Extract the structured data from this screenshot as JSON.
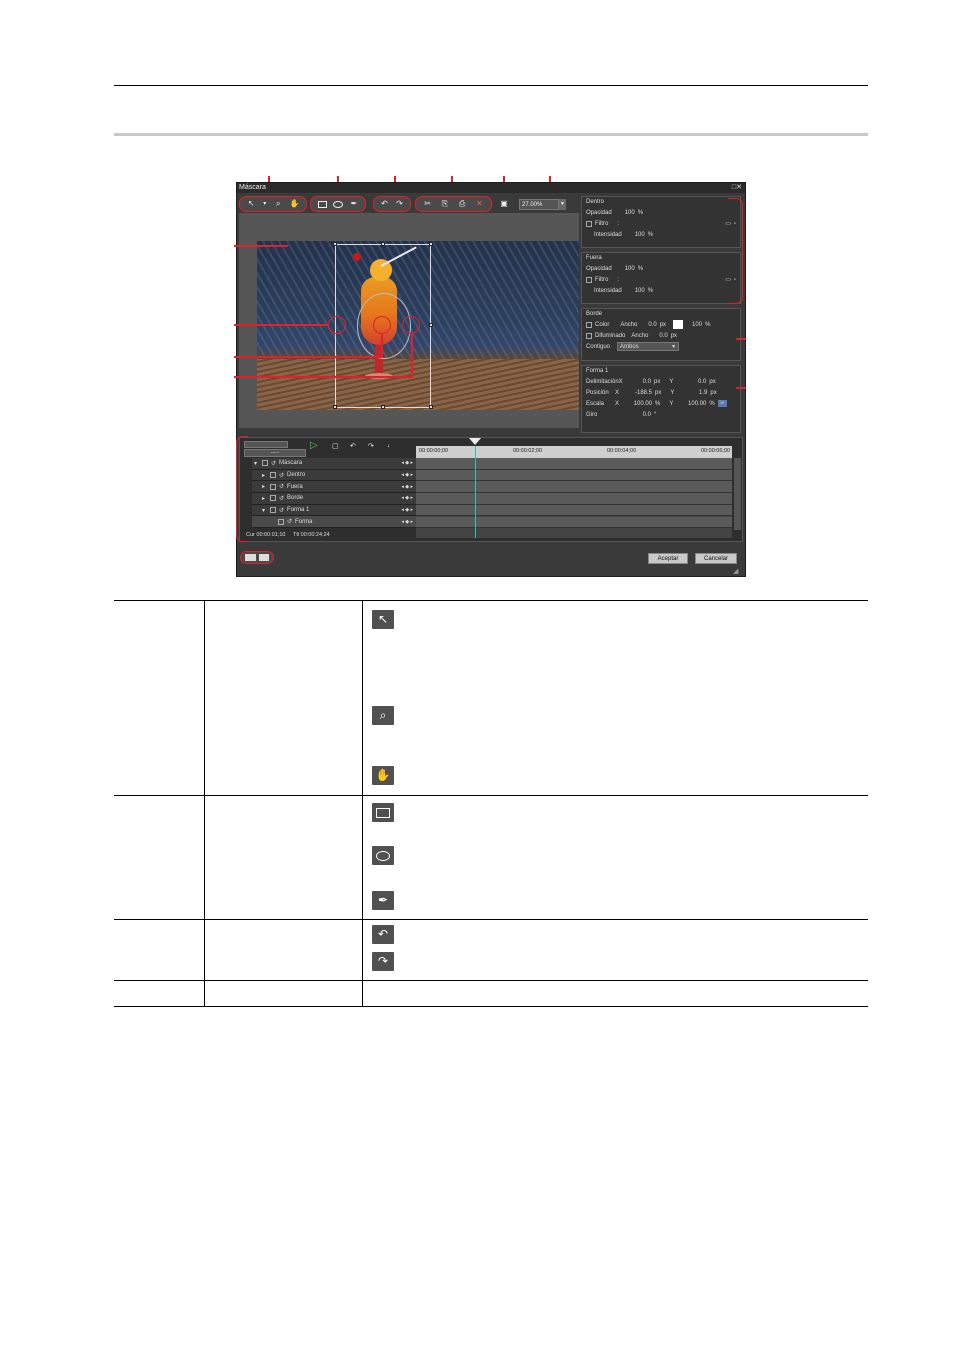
{
  "dialog": {
    "title": "Máscara",
    "window_buttons": "□✕",
    "toolbar": {
      "zoom_value": "27.00%",
      "groups": [
        {
          "name": "tools",
          "icons": [
            "arrow-icon",
            "zoom-icon",
            "hand-icon"
          ]
        },
        {
          "name": "shapes",
          "icons": [
            "rectangle-icon",
            "ellipse-icon",
            "pen-icon"
          ]
        },
        {
          "name": "history",
          "icons": [
            "undo-icon",
            "redo-icon"
          ]
        },
        {
          "name": "edit",
          "icons": [
            "cut-icon",
            "copy-icon",
            "paste-icon",
            "delete-icon"
          ]
        }
      ]
    },
    "panel": {
      "dentro": {
        "title": "Dentro",
        "opacidad_label": "Opacidad",
        "opacidad_value": "100",
        "opacidad_unit": "%",
        "filtro_label": "Filtro",
        "filtro_value": ":",
        "intensidad_label": "Intensidad",
        "intensidad_value": "100",
        "intensidad_unit": "%"
      },
      "fuera": {
        "title": "Fuera",
        "opacidad_label": "Opacidad",
        "opacidad_value": "100",
        "opacidad_unit": "%",
        "filtro_label": "Filtro",
        "filtro_value": ":",
        "intensidad_label": "Intensidad",
        "intensidad_value": "100",
        "intensidad_unit": "%"
      },
      "borde": {
        "title": "Borde",
        "color_label": "Color",
        "ancho_label": "Ancho",
        "ancho_value": "0.0",
        "ancho_unit": "px",
        "color_pct": "100",
        "color_pct_unit": "%",
        "difuminado_label": "Difuminado",
        "ancho2_label": "Ancho",
        "ancho2_value": "0.0",
        "ancho2_unit": "px",
        "contiguo_label": "Contiguo",
        "contiguo_value": "Ambos"
      },
      "forma": {
        "title": "Forma 1",
        "delim_label": "DelimitaciónX",
        "delim_x": "0.0",
        "delim_x_unit": "px",
        "delim_y_label": "Y",
        "delim_y": "0.0",
        "delim_y_unit": "px",
        "pos_label": "Posición",
        "pos_x_label": "X",
        "pos_x": "-188.5",
        "pos_x_unit": "px",
        "pos_y_label": "Y",
        "pos_y": "1.9",
        "pos_y_unit": "px",
        "esc_label": "Escala",
        "esc_x_label": "X",
        "esc_x": "100.00",
        "esc_x_unit": "%",
        "esc_y_label": "Y",
        "esc_y": "100.00",
        "esc_y_unit": "%",
        "giro_label": "Giro",
        "giro_value": "0.0",
        "giro_unit": "°"
      }
    },
    "timeline": {
      "ruler": [
        "00:00:00;00",
        "00:00:02;00",
        "00:00:04;00",
        "00:00:06;00"
      ],
      "tracks": [
        {
          "label": "Máscara",
          "level": 0,
          "expanded": true
        },
        {
          "label": "Dentro",
          "level": 1,
          "expanded": false
        },
        {
          "label": "Fuera",
          "level": 1,
          "expanded": false
        },
        {
          "label": "Borde",
          "level": 1,
          "expanded": false
        },
        {
          "label": "Forma 1",
          "level": 1,
          "expanded": true
        },
        {
          "label": "Forma",
          "level": 2,
          "expanded": false
        }
      ],
      "cur_label": "Cur",
      "cur_value": "00:00:01;10",
      "ttl_label": "Ttl",
      "ttl_value": "00:00:24;24",
      "stepper_value": "-----"
    },
    "buttons": {
      "ok": "Aceptar",
      "cancel": "Cancelar"
    }
  },
  "table": {
    "rows": [
      {
        "icons": [
          "arrow-icon",
          "zoom-icon",
          "hand-icon"
        ]
      },
      {
        "icons": [
          "rectangle-icon",
          "ellipse-icon",
          "pen-icon"
        ]
      },
      {
        "icons": [
          "undo-icon",
          "redo-icon"
        ]
      },
      {
        "icons": []
      }
    ]
  }
}
